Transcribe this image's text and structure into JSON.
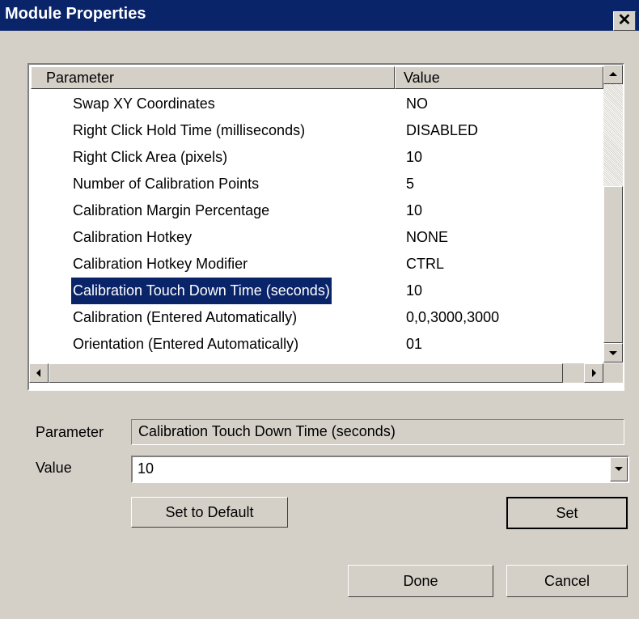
{
  "window": {
    "title": "Module Properties",
    "close_glyph": "✕"
  },
  "list": {
    "headers": {
      "parameter": "Parameter",
      "value": "Value"
    },
    "rows": [
      {
        "name": "Swap XY Coordinates",
        "value": "NO"
      },
      {
        "name": "Right Click Hold Time (milliseconds)",
        "value": "DISABLED"
      },
      {
        "name": "Right Click Area (pixels)",
        "value": "10"
      },
      {
        "name": "Number of Calibration Points",
        "value": "5"
      },
      {
        "name": "Calibration Margin Percentage",
        "value": "10"
      },
      {
        "name": "Calibration Hotkey",
        "value": "NONE"
      },
      {
        "name": "Calibration Hotkey Modifier",
        "value": "CTRL"
      },
      {
        "name": "Calibration Touch Down Time (seconds)",
        "value": "10"
      },
      {
        "name": "Calibration (Entered Automatically)",
        "value": "0,0,3000,3000"
      },
      {
        "name": "Orientation (Entered Automatically)",
        "value": "01"
      }
    ],
    "selected_row": "Calibration Touch Down Time (seconds)"
  },
  "editor": {
    "parameter_label": "Parameter",
    "parameter_value": "Calibration Touch Down Time (seconds)",
    "value_label": "Value",
    "value_current": "10",
    "set_default_label": "Set to Default",
    "set_label": "Set"
  },
  "footer": {
    "done_label": "Done",
    "cancel_label": "Cancel"
  },
  "colors": {
    "titlebar": "#0a246a",
    "face": "#d4d0c8",
    "selection": "#0a246a"
  }
}
